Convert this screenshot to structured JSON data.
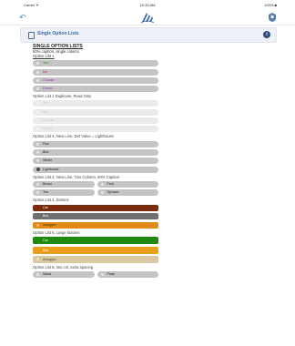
{
  "status": {
    "carrier": "Carrier ✦",
    "time": "10:33 AM",
    "battery": "100% ■"
  },
  "header": {
    "title": "Single Option Lists"
  },
  "main": {
    "title": "SINGLE OPTION LISTS",
    "caption": "50% caption, single column",
    "list1_label": "Option List 1",
    "list1": [
      {
        "label": "Yes",
        "color": "#2e8b2e"
      },
      {
        "label": "No",
        "color": "#d02020"
      },
      {
        "label": "Choose",
        "color": "#b020b0"
      },
      {
        "label": "Dunno",
        "color": "#8e3fbf"
      }
    ],
    "list1b_label": "Option List 1 Duplicate, Read Only",
    "list1b": [
      "Yes",
      "No",
      "Choose",
      "Dunno"
    ],
    "list2_label": "Option List 2, New Line, Def Value = Lighthouse",
    "list2": [
      "Fish",
      "Bird",
      "Whale",
      "Lighthouse"
    ],
    "list2_selected": "Lighthouse",
    "list3_label": "Option List 3, New Line, Two Column, 50% Caption",
    "list3": [
      [
        "Bread",
        "Fruit"
      ],
      [
        "Tea",
        "Spinach"
      ]
    ],
    "list4_label": "Option List 4, buttons",
    "list4": [
      {
        "label": "Car",
        "color": "#7a2c0c"
      },
      {
        "label": "Bus",
        "color": "#6f6f6f"
      },
      {
        "label": "Autogyro",
        "color": "#e38a16"
      }
    ],
    "list5_label": "Option List 5, Large buttons",
    "list5": [
      {
        "label": "Car",
        "color": "#1f8a0f"
      },
      {
        "label": "Bus",
        "color": "#e89d1b"
      },
      {
        "label": "Autogyro",
        "color": "#d9c9a3"
      }
    ],
    "list6_label": "Option List 6, two col, extra spacing",
    "list6": [
      "Salad",
      "Peas"
    ]
  }
}
